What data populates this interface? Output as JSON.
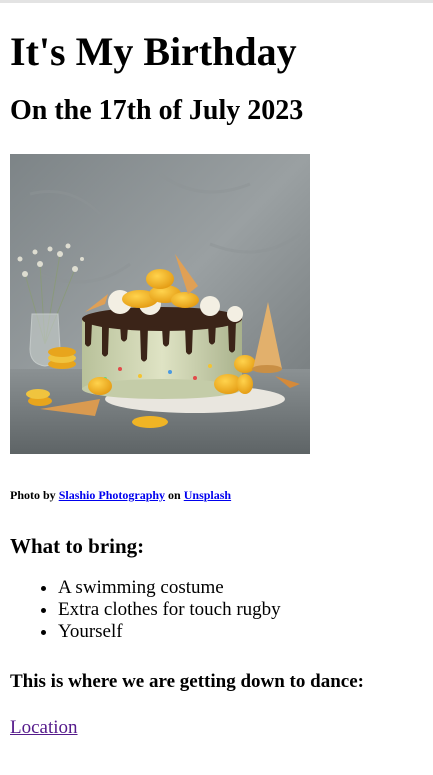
{
  "page": {
    "title": "It's My Birthday",
    "date": "On the 17th of July 2023"
  },
  "photo": {
    "alt": "Birthday cake with macarons and cones",
    "credit_prefix": "Photo by",
    "photographer": "Slashio Photography",
    "credit_middle": "on",
    "site": "Unsplash"
  },
  "bring": {
    "title": "What to bring:",
    "items": [
      "A swimming costume",
      "Extra clothes for touch rugby",
      "Yourself"
    ]
  },
  "dance": {
    "title": "This is where we are getting down to dance:",
    "link_label": "Location"
  },
  "colors": {
    "link": "#0000ee",
    "visited_link": "#551a8b"
  }
}
